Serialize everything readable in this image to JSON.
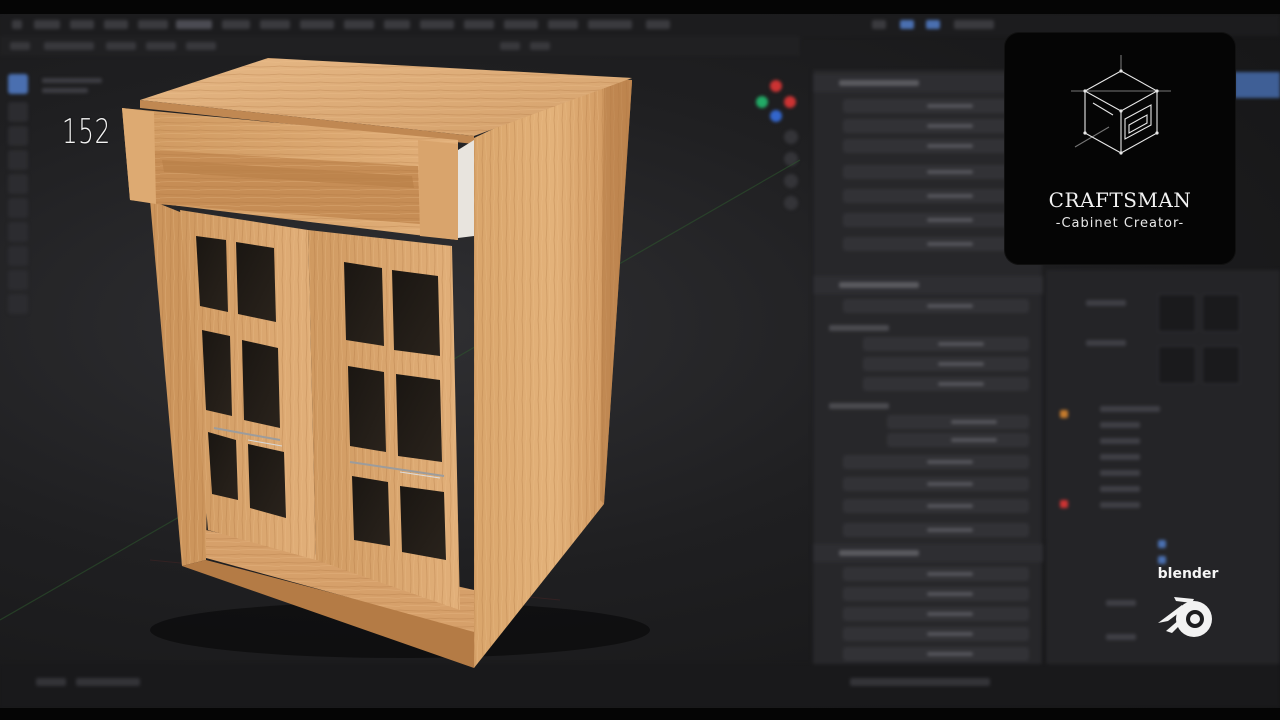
{
  "viewport": {
    "frame_counter": "152"
  },
  "logo": {
    "title": "CRAFTSMAN",
    "subtitle": "-Cabinet Creator-",
    "icon": "cabinet-wireframe-icon"
  },
  "blender_badge": {
    "label": "blender",
    "icon": "blender-logo-icon"
  },
  "colors": {
    "wood_light": "#e0b27c",
    "wood_mid": "#c8925a",
    "wood_dark": "#a0693a",
    "ui_dark": "#27272a",
    "accent_blue": "#4a6fb0",
    "logo_bg": "#050505"
  }
}
